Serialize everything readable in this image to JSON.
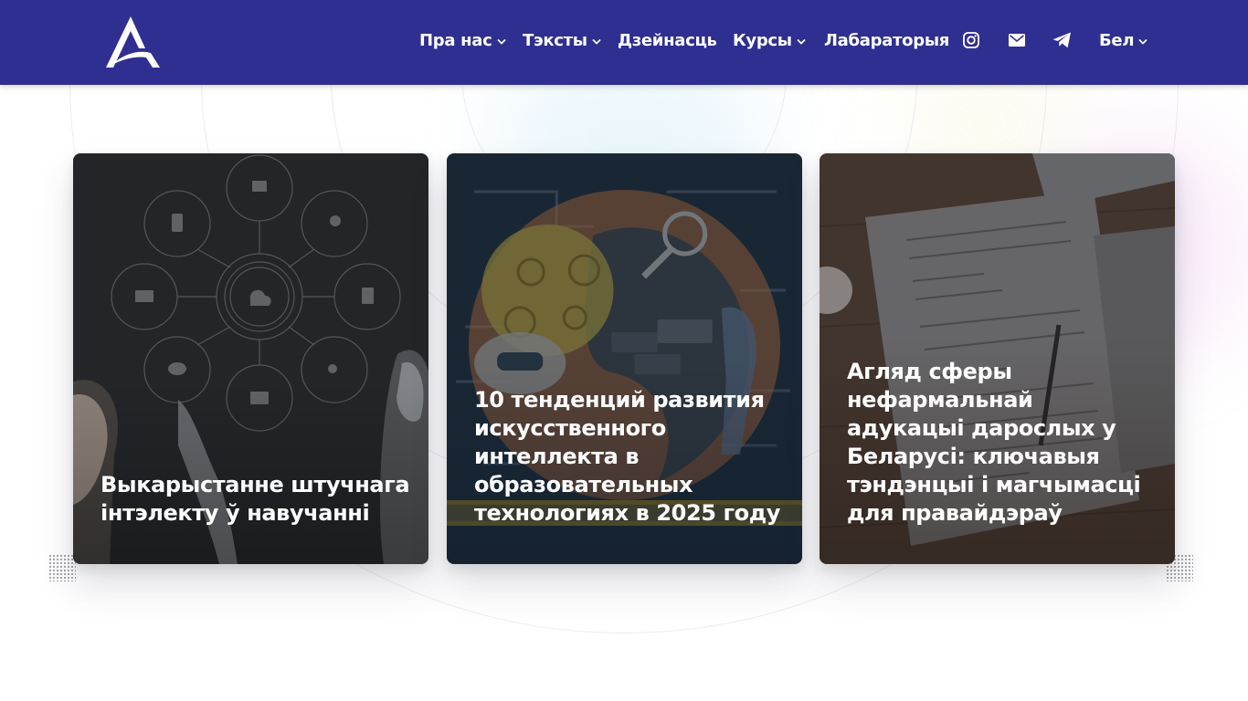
{
  "header": {
    "logo_icon": "brand-logo-icon",
    "nav": [
      {
        "label": "Пра нас",
        "has_dropdown": true
      },
      {
        "label": "Тэксты",
        "has_dropdown": true
      },
      {
        "label": "Дзейнасць",
        "has_dropdown": false
      },
      {
        "label": "Курсы",
        "has_dropdown": true
      },
      {
        "label": "Лабараторыя",
        "has_dropdown": false
      }
    ],
    "social_icons": [
      "instagram-icon",
      "mail-icon",
      "telegram-icon"
    ],
    "language": {
      "label": "Бел",
      "has_dropdown": true
    },
    "colors": {
      "background": "#2f2f91",
      "text": "#ffffff"
    }
  },
  "cards": [
    {
      "title": "Выкарыстанне штучнага інтэлекту ў навучанні",
      "image": "ai-education-network-image"
    },
    {
      "title": "10 тенденций развития искусственного интеллекта в образовательных технологиях в 2025 году",
      "image": "ai-brain-globe-illustration"
    },
    {
      "title": "Агляд сферы нефармальнай адукацыі дарослых у Беларусі: ключавыя тэндэнцыі і магчымасці для правайдэраў",
      "image": "documents-desk-photo"
    }
  ]
}
